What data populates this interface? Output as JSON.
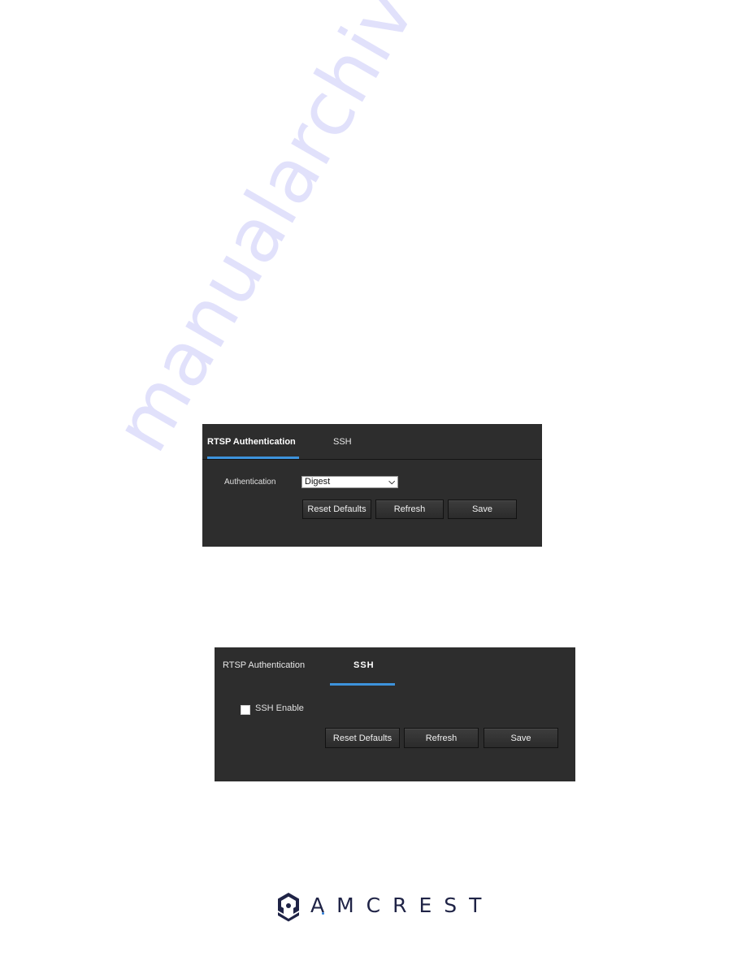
{
  "watermark": "manualarchive.com",
  "colors": {
    "panel_bg": "#2d2d2d",
    "tab_accent": "#3d93dc",
    "logo_navy": "#1f2346",
    "logo_dot": "#2e7dd6"
  },
  "panels": [
    {
      "tabs": [
        {
          "label": "RTSP Authentication",
          "active": true
        },
        {
          "label": "SSH",
          "active": false
        }
      ],
      "fields": {
        "authentication_label": "Authentication",
        "authentication_value": "Digest"
      },
      "buttons": {
        "reset": "Reset Defaults",
        "refresh": "Refresh",
        "save": "Save"
      }
    },
    {
      "tabs": [
        {
          "label": "RTSP Authentication",
          "active": false
        },
        {
          "label": "SSH",
          "active": true
        }
      ],
      "fields": {
        "ssh_enable_label": "SSH Enable",
        "ssh_enable_checked": false
      },
      "buttons": {
        "reset": "Reset Defaults",
        "refresh": "Refresh",
        "save": "Save"
      }
    }
  ],
  "logo": {
    "brand": "AMCREST",
    "icon": "amcrest-hexagon-logo-icon"
  }
}
